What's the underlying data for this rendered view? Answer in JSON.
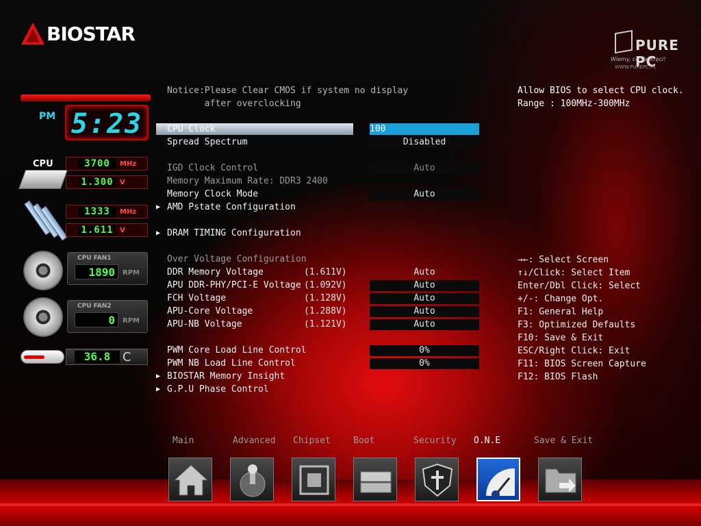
{
  "brand": {
    "logo_text": "BIOSTAR",
    "watermark": "PURE PC",
    "watermark_tag": "Wiemy, co się kręci!",
    "watermark_url": "WWW.PUREPC.PL"
  },
  "clock": {
    "ampm": "PM",
    "time": "5:23"
  },
  "monitor": {
    "cpu_label": "CPU",
    "cpu_freq": "3700",
    "cpu_freq_unit": "MHz",
    "cpu_volt": "1.300",
    "cpu_volt_unit": "V",
    "mem_freq": "1333",
    "mem_freq_unit": "MHz",
    "mem_volt": "1.611",
    "mem_volt_unit": "V",
    "fan1_title": "CPU FAN1",
    "fan1_rpm": "1890",
    "fan1_unit": "RPM",
    "fan2_title": "CPU FAN2",
    "fan2_rpm": "0",
    "fan2_unit": "RPM",
    "temp": "36.8",
    "temp_unit": "C"
  },
  "notice": "Notice:Please Clear CMOS if system no display\n       after overclocking",
  "help_text": "Allow BIOS to select CPU clock. Range : 100MHz-300MHz",
  "settings": [
    {
      "label": "CPU Clock",
      "value": "100"
    },
    {
      "label": "Spread Spectrum",
      "value": "Disabled"
    },
    {
      "label": "IGD Clock Control",
      "value": "Auto"
    },
    {
      "label": "Memory Maximum Rate: DDR3 2400"
    },
    {
      "label": "Memory Clock Mode",
      "value": "Auto"
    },
    {
      "label": "AMD Pstate Configuration"
    },
    {
      "label": "DRAM TIMING Configuration"
    },
    {
      "label": "Over Voltage Configuration"
    },
    {
      "label": "DDR Memory Voltage",
      "volt": "(1.611V)",
      "value": "Auto"
    },
    {
      "label": "APU DDR-PHY/PCI-E Voltage",
      "volt": "(1.092V)",
      "value": "Auto"
    },
    {
      "label": "FCH Voltage",
      "volt": "(1.128V)",
      "value": "Auto"
    },
    {
      "label": "APU-Core Voltage",
      "volt": "(1.288V)",
      "value": "Auto"
    },
    {
      "label": "APU-NB Voltage",
      "volt": "(1.121V)",
      "value": "Auto"
    },
    {
      "label": "PWM Core Load Line Control",
      "value": "0%"
    },
    {
      "label": "PWM NB Load Line Control",
      "value": "0%"
    },
    {
      "label": "BIOSTAR Memory Insight"
    },
    {
      "label": "G.P.U Phase Control"
    }
  ],
  "keys": [
    "→←: Select Screen",
    "↑↓/Click: Select Item",
    "Enter/Dbl Click: Select",
    "+/-: Change Opt.",
    "F1: General Help",
    "F3: Optimized Defaults",
    "F10: Save & Exit",
    "ESC/Right Click: Exit",
    "F11: BIOS Screen Capture",
    "F12: BIOS Flash"
  ],
  "tabs": [
    {
      "label": "Main",
      "icon": "home-icon"
    },
    {
      "label": "Advanced",
      "icon": "joystick-icon"
    },
    {
      "label": "Chipset",
      "icon": "chip-icon"
    },
    {
      "label": "Boot",
      "icon": "drive-icon"
    },
    {
      "label": "Security",
      "icon": "shield-icon"
    },
    {
      "label": "O.N.E",
      "icon": "gauge-icon",
      "active": true
    },
    {
      "label": "Save & Exit",
      "icon": "exit-folder-icon"
    }
  ]
}
